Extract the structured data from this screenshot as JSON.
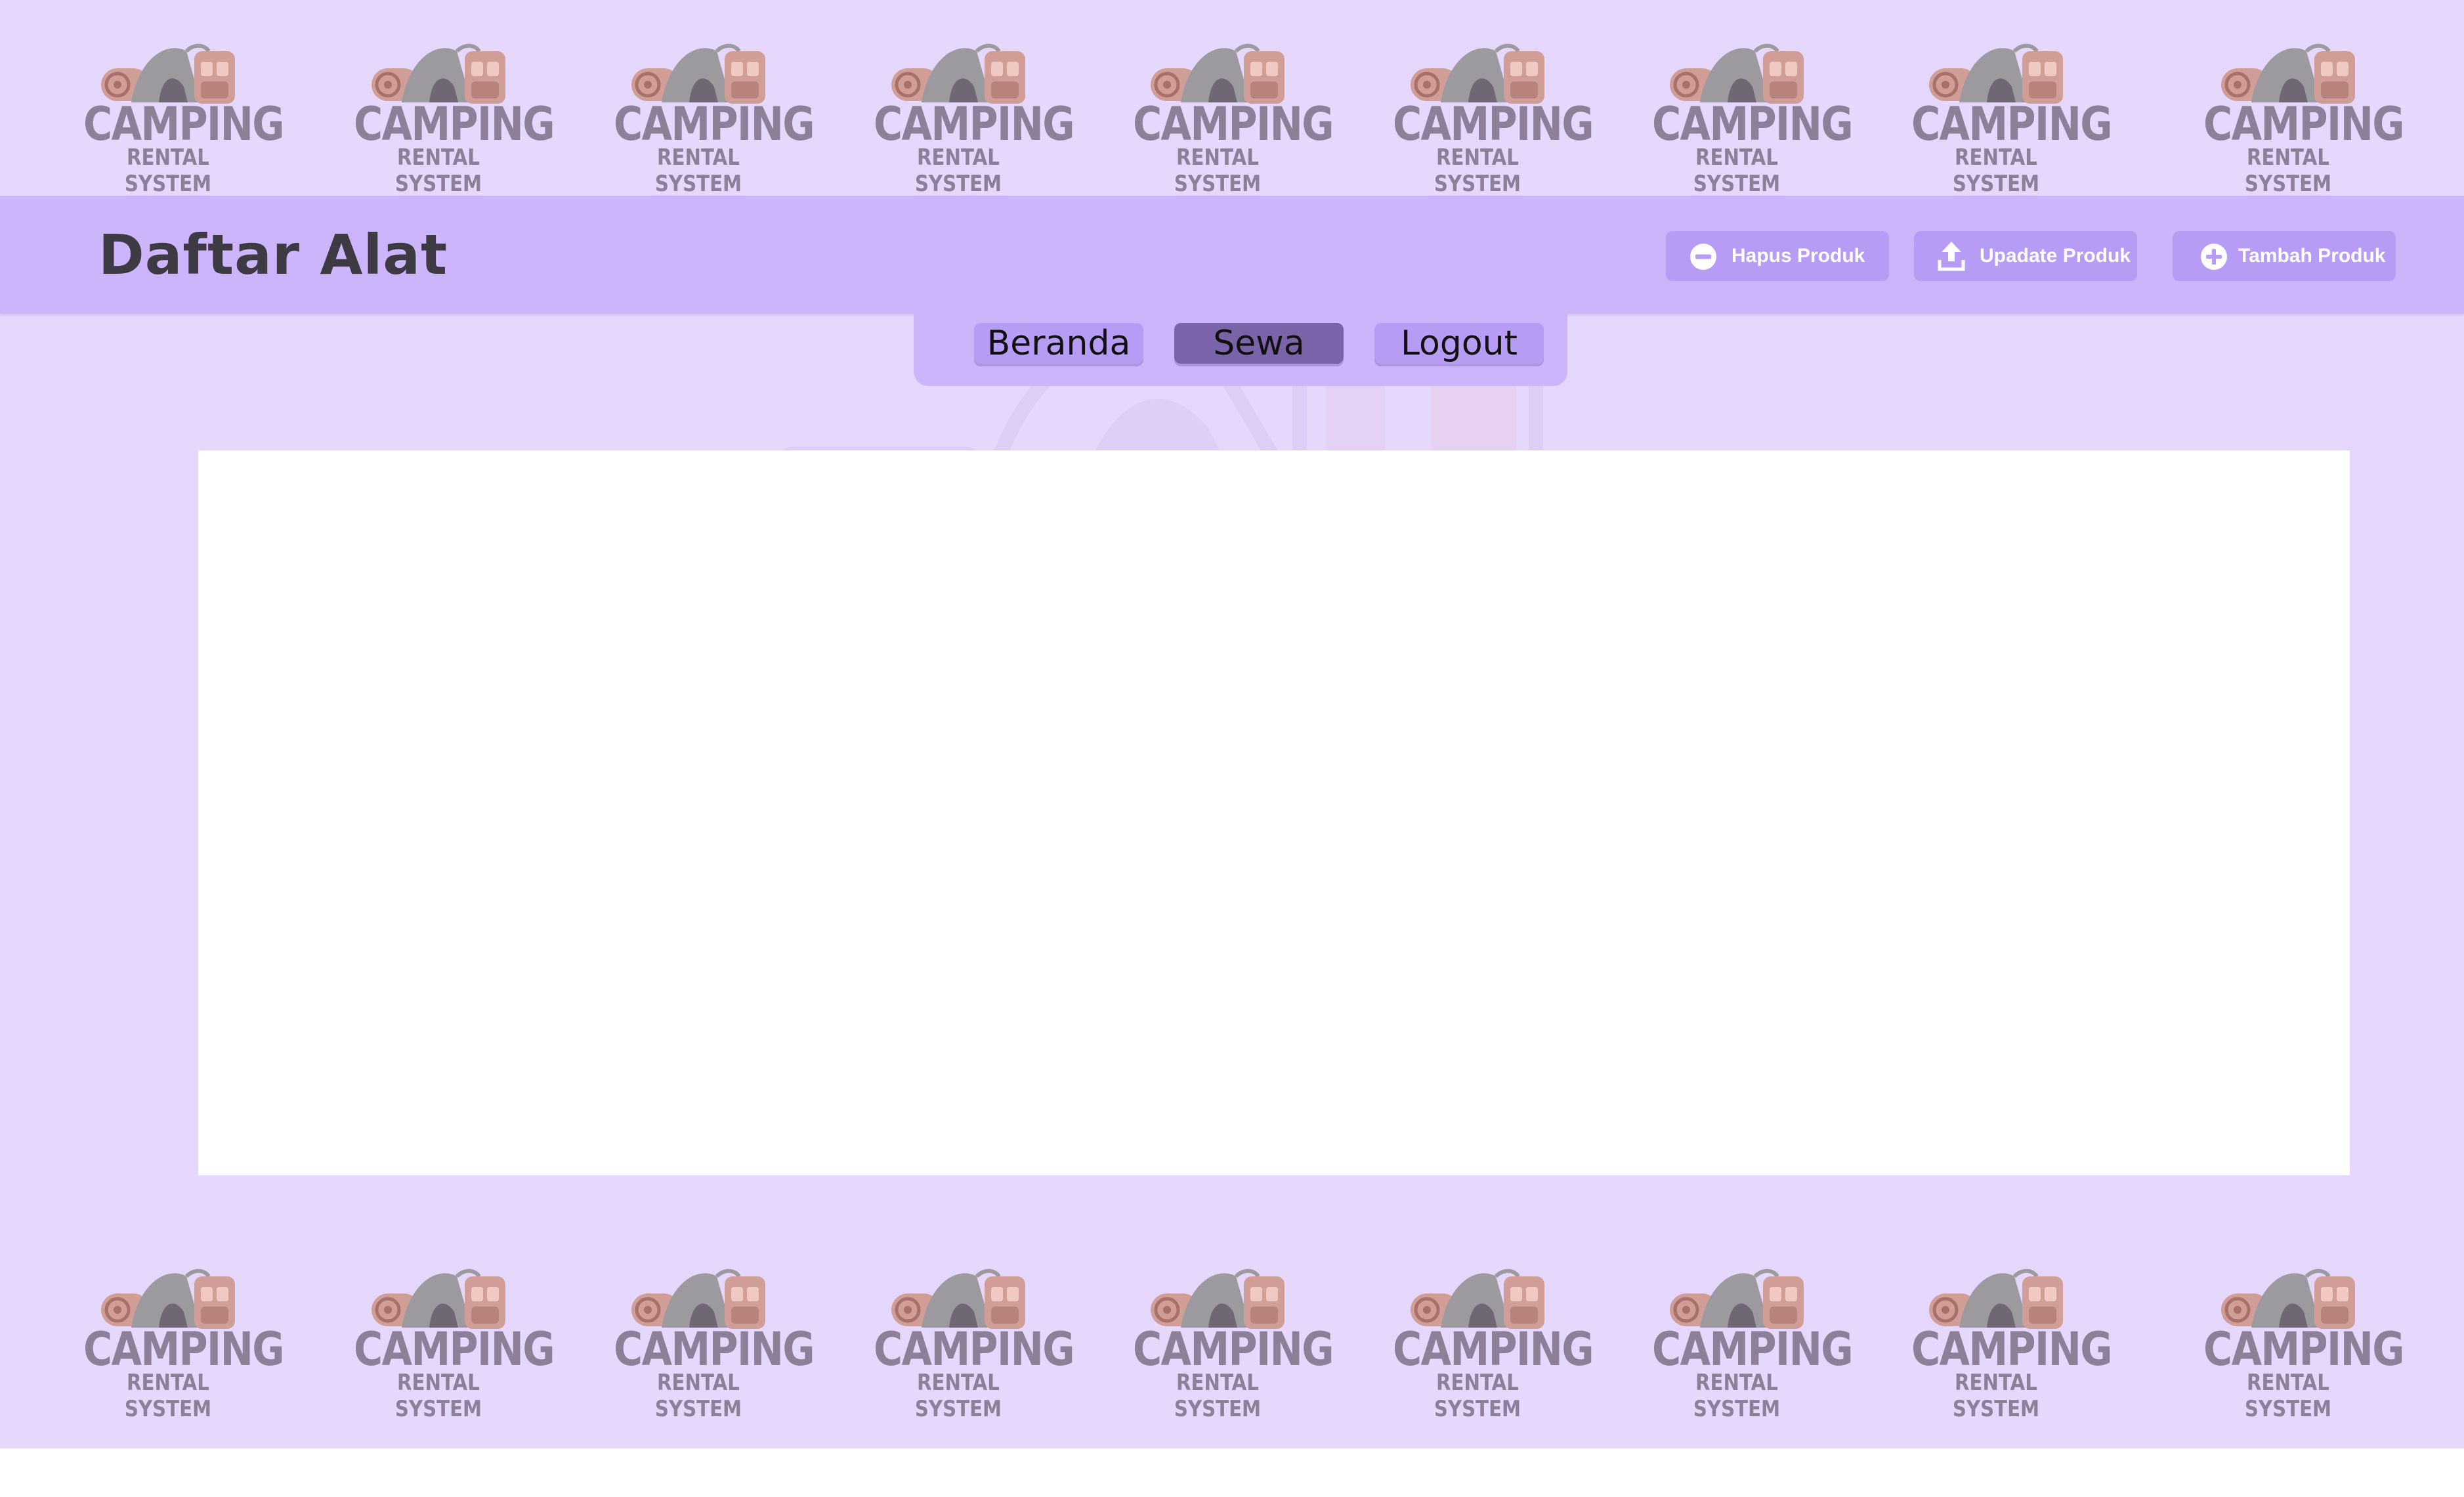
{
  "brand": {
    "logo_line1": "CAMPING",
    "logo_line2": "RENTAL SYSTEM",
    "logo_icon": "camping-gear-icon"
  },
  "header": {
    "title": "Daftar Alat",
    "actions": [
      {
        "label": "Hapus Produk",
        "icon": "minus-circle-icon"
      },
      {
        "label": "Upadate Produk",
        "icon": "upload-icon"
      },
      {
        "label": "Tambah Produk",
        "icon": "plus-circle-icon"
      }
    ]
  },
  "nav": {
    "items": [
      {
        "label": "Beranda",
        "active": false
      },
      {
        "label": "Sewa",
        "active": true
      },
      {
        "label": "Logout",
        "active": false
      }
    ]
  },
  "colors": {
    "background": "#e6d8fd",
    "header": "#cdb5fb",
    "button": "#b79cf6",
    "button_active": "#7a63a8",
    "text_dark": "#3e3a44",
    "logo_text": "#8e7f99"
  }
}
